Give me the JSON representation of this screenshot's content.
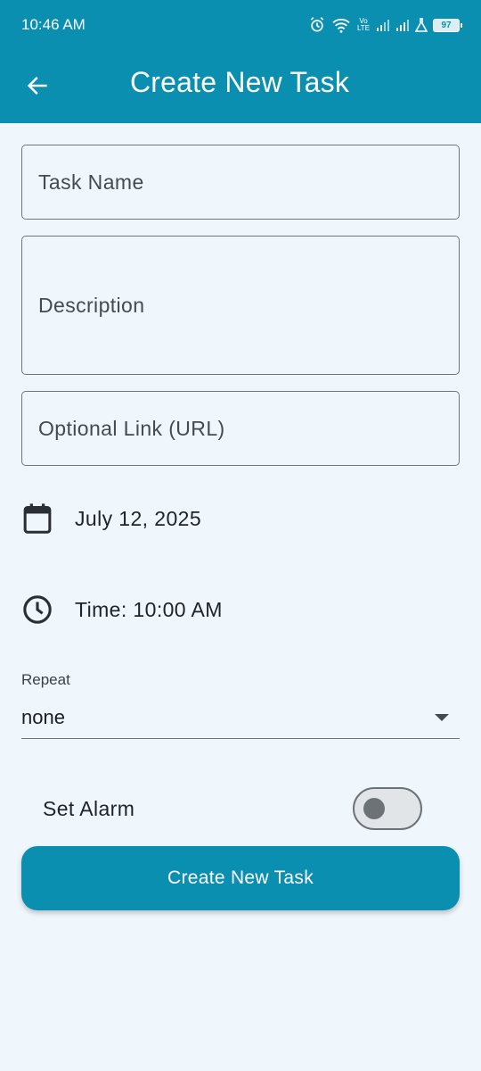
{
  "status_bar": {
    "time": "10:46 AM",
    "battery": "97",
    "icons": [
      "alarm-icon",
      "wifi-icon",
      "volte-icon",
      "signal-icon",
      "signal-icon",
      "lab-icon",
      "battery-icon"
    ],
    "volte_label": "Vo LTE"
  },
  "app_bar": {
    "title": "Create New Task",
    "back_icon": "arrow-back-icon",
    "color": "#0B8FB0"
  },
  "form": {
    "task_name_placeholder": "Task Name",
    "description_placeholder": "Description",
    "link_placeholder": "Optional Link (URL)",
    "date": "July 12, 2025",
    "date_icon": "calendar-icon",
    "time": "Time: 10:00 AM",
    "time_icon": "clock-icon",
    "repeat_label": "Repeat",
    "repeat_value": "none",
    "alarm_label": "Set Alarm",
    "alarm_enabled": false,
    "submit_label": "Create New Task"
  },
  "colors": {
    "accent": "#0B8FB0",
    "background": "#EFF6FC",
    "outline": "#6f767b"
  }
}
